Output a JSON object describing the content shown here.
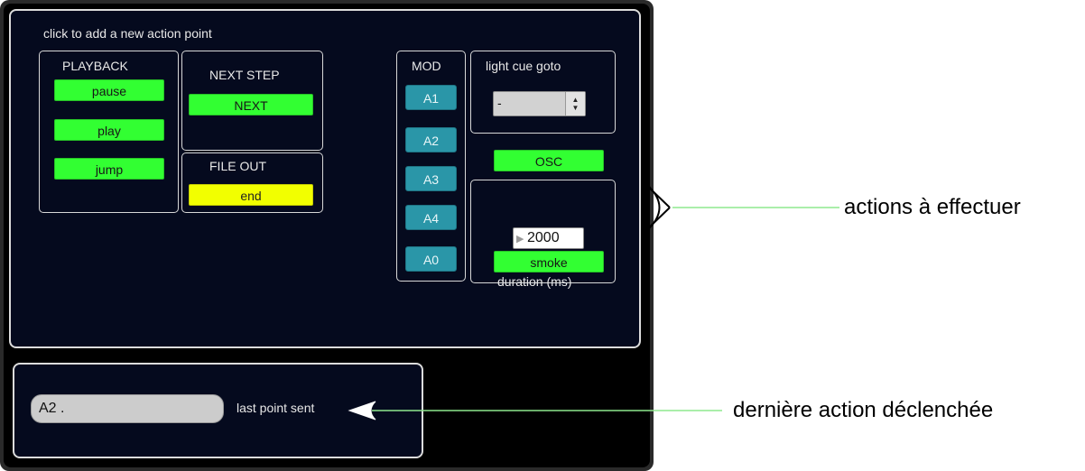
{
  "hint": "click to add a new  action point",
  "playback": {
    "title": "PLAYBACK",
    "buttons": [
      "pause",
      "play",
      "jump"
    ]
  },
  "next_step": {
    "title": "NEXT STEP",
    "button": "NEXT"
  },
  "file_out": {
    "title": "FILE OUT",
    "button": "end"
  },
  "mod": {
    "title": "MOD",
    "buttons": [
      "A1",
      "A2",
      "A3",
      "A4",
      "A0"
    ]
  },
  "light_cue": {
    "title": "light cue goto",
    "value": "-"
  },
  "osc": {
    "button": "OSC"
  },
  "smoke": {
    "duration_value": "2000",
    "button": "smoke",
    "label": "duration (ms)"
  },
  "last_point": {
    "value": "A2 .",
    "label": "last point sent"
  },
  "annotations": {
    "actions": "actions à effectuer",
    "last_action": "dernière action déclenchée"
  },
  "colors": {
    "green_button": "#32ff32",
    "yellow_button": "#f2ff00",
    "teal_button": "#2a96a8",
    "panel_bg": "#050a1e",
    "arrow_line": "#8ee88e"
  }
}
